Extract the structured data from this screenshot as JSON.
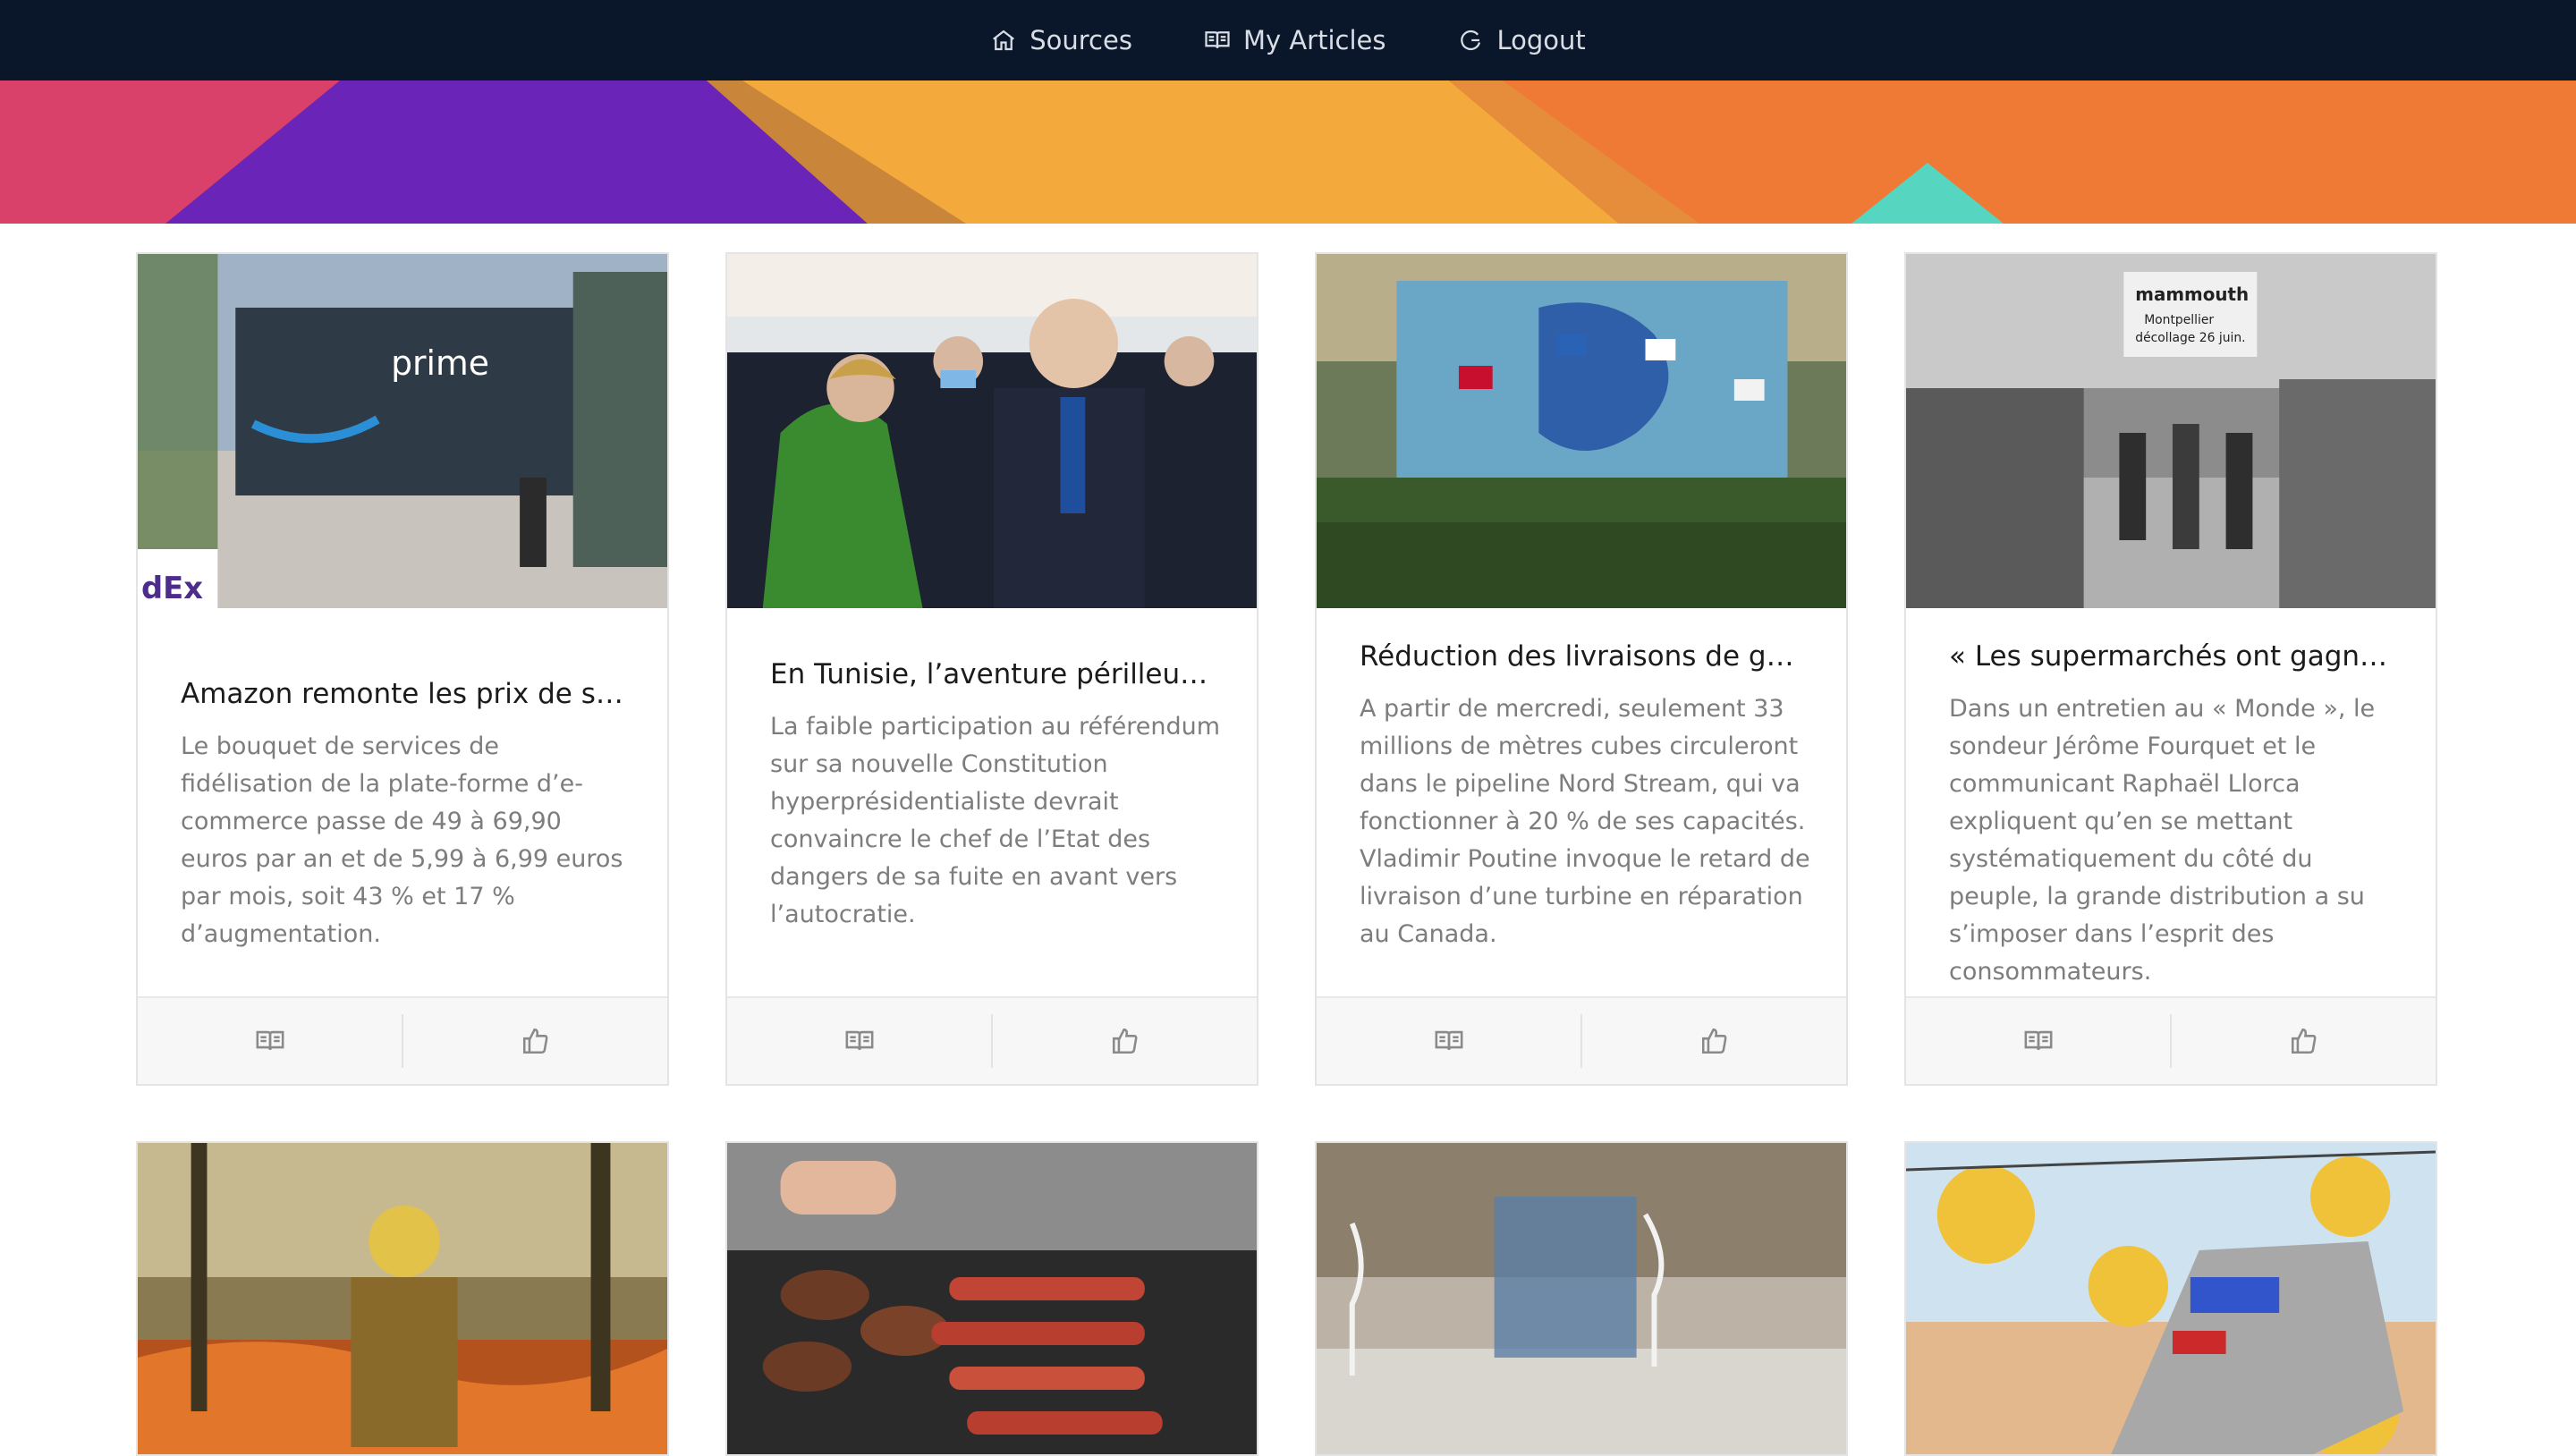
{
  "nav": {
    "items": [
      {
        "label": "Sources",
        "icon": "home-icon"
      },
      {
        "label": "My Articles",
        "icon": "book-icon"
      },
      {
        "label": "Logout",
        "icon": "logout-icon"
      }
    ]
  },
  "colors": {
    "nav_bg": "#0a1629",
    "banner": [
      "#d9406a",
      "#6a25b8",
      "#f3a93b",
      "#ee7a36",
      "#56d6c1"
    ]
  },
  "articles": [
    {
      "title": "Amazon remonte les prix de so...",
      "summary": "Le bouquet de services de fidélisation de la plate-forme d’e-commerce passe de 49 à 69,90 euros par an et de 5,99 à 6,99 euros par mois, soit 43 % et 17 % d’augmentation.",
      "image": "amazon-prime-truck",
      "image_text": "prime"
    },
    {
      "title": "En Tunisie, l’aventure périlleuse...",
      "summary": "La faible participation au référendum sur sa nouvelle Constitution hyperprésidentialiste devrait convaincre le chef de l’Etat des dangers de sa fuite en avant vers l’autocratie.",
      "image": "tunisia-president-photo"
    },
    {
      "title": "Réduction des livraisons de gaz...",
      "summary": "A partir de mercredi, seulement 33 millions de mètres cubes circuleront dans le pipeline Nord Stream, qui va fonctionner à 20 % de ses capacités. Vladimir Poutine invoque le retard de livraison d’une turbine en réparation au Canada.",
      "image": "nord-stream-container"
    },
    {
      "title": "« Les supermarchés ont gagné ...",
      "summary": "Dans un entretien au « Monde », le sondeur Jérôme Fourquet et le communicant Raphaël Llorca expliquent qu’en se mettant systématiquement du côté du peuple, la grande distribution a su s’imposer dans l’esprit des consommateurs.",
      "image": "supermarket-bw-photo",
      "image_text": [
        "mammouth",
        "Montpellier",
        "décollage 26 juin."
      ]
    }
  ],
  "row2_images": [
    "firefighter-photo",
    "barbecue-photo",
    "restaurant-photo",
    "train-coins-illustration"
  ]
}
